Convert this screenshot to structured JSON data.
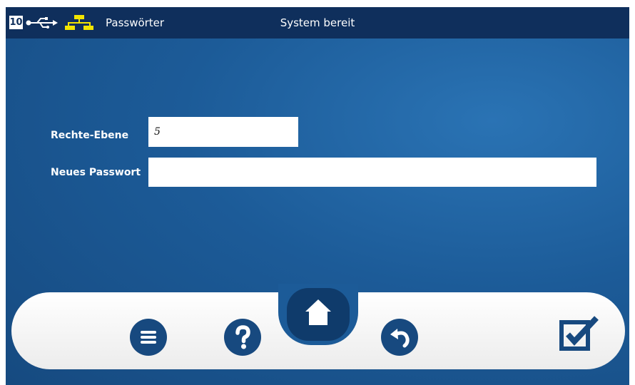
{
  "topbar": {
    "channel_number": "10",
    "usb_icon": "usb-icon",
    "network_icon": "network-icon",
    "screen_title": "Passwörter",
    "status": "System bereit"
  },
  "form": {
    "rights_level_label": "Rechte-Ebene",
    "rights_level_value": "5",
    "new_password_label": "Neues Passwort",
    "new_password_value": ""
  },
  "toolbar": {
    "menu_icon": "menu-icon",
    "help_icon": "help-icon",
    "home_icon": "home-icon",
    "back_icon": "undo-icon",
    "confirm_icon": "checkbox-check-icon"
  },
  "colors": {
    "background": "#1c5b98",
    "topbar": "#0f2f5c",
    "accent_yellow": "#f2e500",
    "button": "#17497f",
    "toolbar": "#f4f4f4"
  }
}
